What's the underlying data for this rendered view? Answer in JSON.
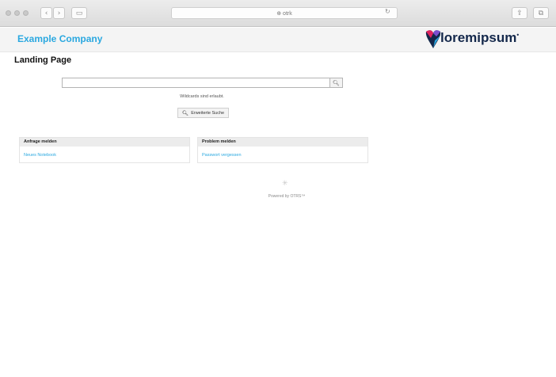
{
  "browser": {
    "url_text": "⊕ otrk",
    "back_glyph": "‹",
    "forward_glyph": "›",
    "sidebar_glyph": "▭",
    "reload_glyph": "↻",
    "share_glyph": "⇪",
    "tabs_glyph": "⧉"
  },
  "header": {
    "company": "Example Company",
    "logo_text": "loremipsum",
    "logo_dot": "•",
    "brand_color": "#2aa8e0"
  },
  "page_title": "Landing Page",
  "search": {
    "value": "",
    "button_icon": "search-icon",
    "button_glyph": "🔍︎",
    "hint": "Wildcards sind erlaubt.",
    "advanced_label": "Erweiterte Suche",
    "advanced_icon_glyph": "🔍︎"
  },
  "panels": [
    {
      "title": "Anfrage melden",
      "link": "Neues Notebook"
    },
    {
      "title": "Problem melden",
      "link": "Passwort vergessen"
    }
  ],
  "footer": {
    "icon_glyph": "✳",
    "powered_by": "Powered by OTRS™"
  }
}
